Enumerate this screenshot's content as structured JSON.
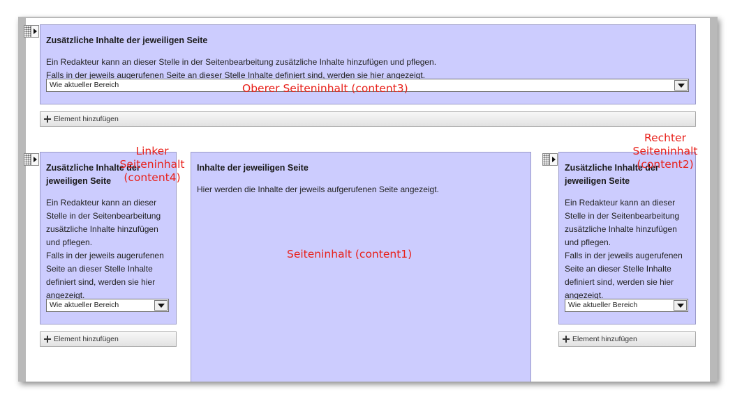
{
  "top_region": {
    "title": "Zusätzliche Inhalte der jeweiligen Seite",
    "line1": "Ein Redakteur kann an dieser Stelle in der Seitenbearbeitung zusätzliche Inhalte hinzufügen und pflegen.",
    "line2": "Falls in der jeweils augerufenen Seite an dieser Stelle Inhalte definiert sind, werden sie hier angezeigt.",
    "select_value": "Wie aktueller Bereich",
    "add_label": "Element hinzufügen",
    "annotation": "Oberer Seiteninhalt (content3)"
  },
  "left_region": {
    "title_line1": "Zusätzliche Inhalte der",
    "title_line2": "jeweiligen Seite",
    "text_lines": [
      "Ein Redakteur kann an dieser",
      "Stelle in der Seitenbearbeitung",
      "zusätzliche Inhalte hinzufügen",
      "und pflegen.",
      "Falls in der jeweils augerufenen",
      "Seite an dieser Stelle Inhalte",
      "definiert sind, werden sie hier",
      "angezeigt."
    ],
    "select_value": "Wie aktueller Bereich",
    "add_label": "Element hinzufügen",
    "annotation_line1": "Linker",
    "annotation_line2": "Seiteninhalt",
    "annotation_line3": "(content4)"
  },
  "center_region": {
    "title": "Inhalte der jeweiligen Seite",
    "text": "Hier werden die Inhalte der jeweils aufgerufenen Seite angezeigt.",
    "annotation": "Seiteninhalt (content1)"
  },
  "right_region": {
    "title_line1": "Zusätzliche Inhalte der",
    "title_line2": "jeweiligen Seite",
    "text_lines": [
      "Ein Redakteur kann an dieser",
      "Stelle in der Seitenbearbeitung",
      "zusätzliche Inhalte hinzufügen",
      "und pflegen.",
      "Falls in der jeweils augerufenen",
      "Seite an dieser Stelle Inhalte",
      "definiert sind, werden sie hier",
      "angezeigt."
    ],
    "select_value": "Wie aktueller Bereich",
    "add_label": "Element hinzufügen",
    "annotation_line1": "Rechter",
    "annotation_line2": "Seiteninhalt",
    "annotation_line3": "(content2)"
  },
  "colors": {
    "region_fill": "#ccccfe",
    "annotation": "#e8211b"
  },
  "icons": {
    "handle": "drag-handle-icon",
    "dropdown": "chevron-down-icon",
    "add": "plus-icon"
  }
}
